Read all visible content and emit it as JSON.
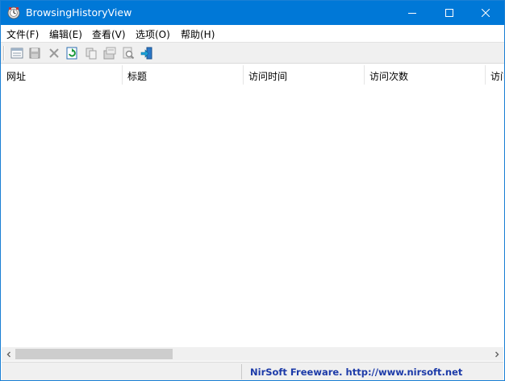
{
  "window": {
    "title": "BrowsingHistoryView",
    "accent_color": "#0078d7"
  },
  "menu": [
    {
      "label": "文件(F)"
    },
    {
      "label": "编辑(E)"
    },
    {
      "label": "查看(V)"
    },
    {
      "label": "选项(O)"
    },
    {
      "label": "帮助(H)"
    }
  ],
  "toolbar": {
    "buttons": [
      {
        "icon": "html-report-icon"
      },
      {
        "icon": "save-icon"
      },
      {
        "icon": "delete-icon"
      },
      {
        "icon": "refresh-icon"
      },
      {
        "icon": "copy-icon"
      },
      {
        "icon": "properties-icon"
      },
      {
        "icon": "find-icon"
      },
      {
        "icon": "exit-icon"
      }
    ]
  },
  "list": {
    "columns": [
      "网址",
      "标题",
      "访问时间",
      "访问次数",
      "访问"
    ],
    "rows": []
  },
  "statusbar": {
    "left_text": "",
    "link_text": "NirSoft Freeware.  http://www.nirsoft.net",
    "link_color": "#1c3aa8"
  }
}
